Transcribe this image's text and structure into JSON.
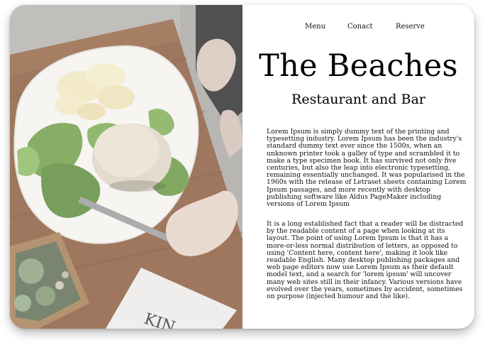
{
  "nav": {
    "items": [
      "Menu",
      "Conact",
      "Reserve"
    ]
  },
  "hero": {
    "title": "The Beaches",
    "subtitle": "Restaurant and Bar",
    "image_alt": "Overhead photo of a burger, salad and chips on a white plate on a wooden table",
    "magazine_text": "KIN"
  },
  "paragraphs": [
    "Lorem Ipsum is simply dummy text of the printing and typesetting industry. Lorem Ipsum has been the industry's standard dummy text ever since the 1500s, when an unknown printer took a galley of type and scrambled it to make a type specimen book. It has survived not only five centuries, but also the leap into electronic typesetting, remaining essentially unchanged. It was popularised in the 1960s with the release of Letraset sheets containing Lorem Ipsum passages, and more recently with desktop publishing software like Aldus PageMaker including versions of Lorem Ipsum",
    "It is a long established fact that a reader will be distracted by the readable content of a page when looking at its layout. The point of using Lorem Ipsum is that it has a more-or-less normal distribution of letters, as opposed to using 'Content here, content here', making it look like readable English. Many desktop publishing packages and web page editors now use Lorem Ipsum as their default model text, and a search for 'lorem ipsum' will uncover many web sites still in their infancy. Various versions have evolved over the years, sometimes by accident, sometimes on purpose (injected humour and the like)."
  ],
  "colors": {
    "background": "#ffffff",
    "text": "#111111",
    "wood": "#8a5a3c",
    "plate": "#f4f3ef",
    "lettuce": "#5f8f3f"
  }
}
